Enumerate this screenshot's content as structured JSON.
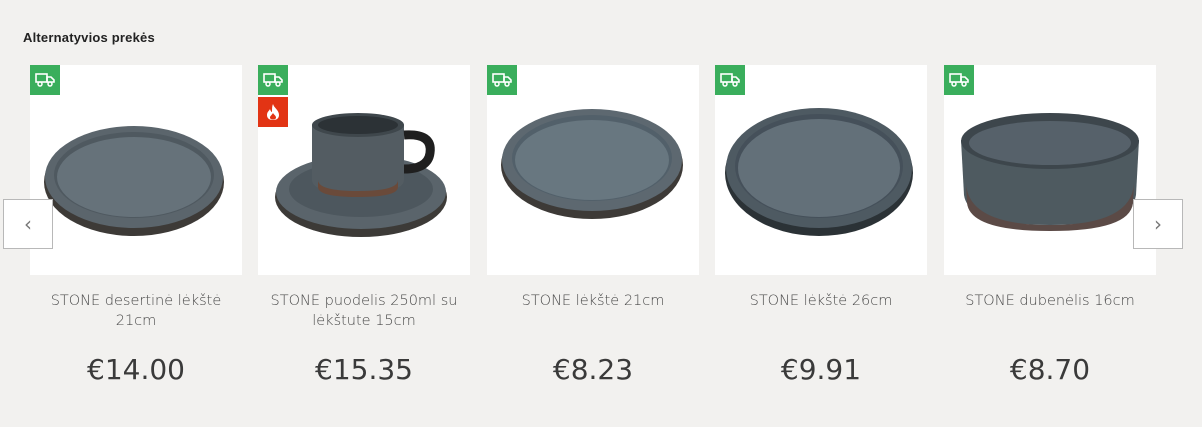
{
  "section": {
    "title": "Alternatyvios prekės"
  },
  "carousel": {
    "prev_label": "‹",
    "next_label": "›",
    "products": [
      {
        "name": "STONE desertinė lėkštė 21cm",
        "price": "€14.00",
        "badges": [
          "truck-icon"
        ],
        "image": "plate-icon"
      },
      {
        "name": "STONE puodelis 250ml su lėkštute 15cm",
        "price": "€15.35",
        "badges": [
          "truck-icon",
          "fire-icon"
        ],
        "image": "cup-saucer-icon"
      },
      {
        "name": "STONE lėkštė 21cm",
        "price": "€8.23",
        "badges": [
          "truck-icon"
        ],
        "image": "plate-icon"
      },
      {
        "name": "STONE lėkštė 26cm",
        "price": "€9.91",
        "badges": [
          "truck-icon"
        ],
        "image": "plate-icon"
      },
      {
        "name": "STONE dubenėlis 16cm",
        "price": "€8.70",
        "badges": [
          "truck-icon"
        ],
        "image": "bowl-icon"
      }
    ]
  },
  "colors": {
    "badge_green": "#3aae5c",
    "badge_red": "#e23414",
    "stoneware": "#5a6770"
  }
}
